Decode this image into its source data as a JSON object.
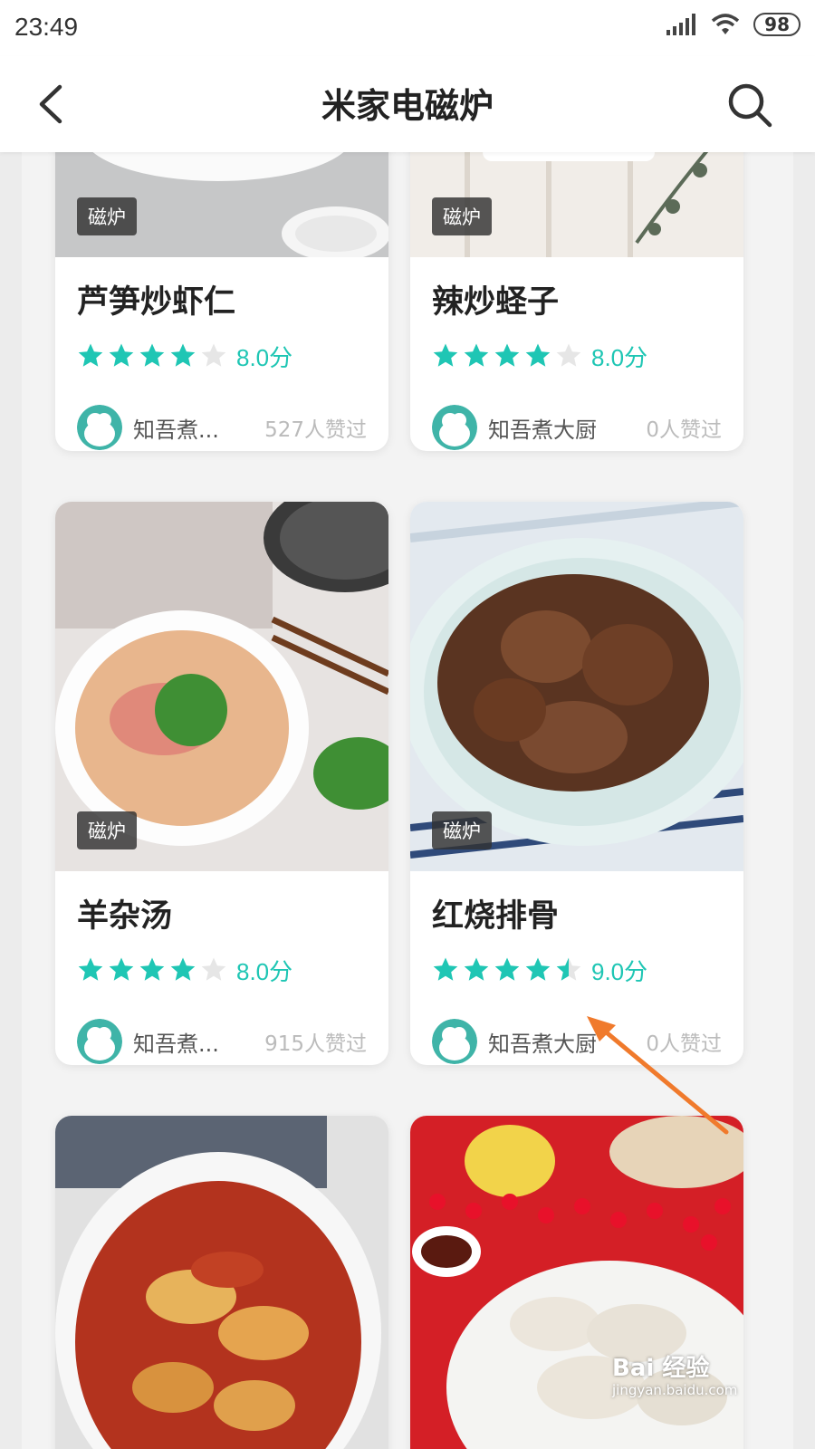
{
  "status": {
    "time": "23:49",
    "battery": "98"
  },
  "header": {
    "title": "米家电磁炉"
  },
  "accent_color": "#1fc6b4",
  "cards": [
    {
      "name": "芦笋炒虾仁",
      "tag": "磁炉",
      "rating_value": 4,
      "score": "8.0分",
      "author": "知吾煮...",
      "likes": "527人赞过"
    },
    {
      "name": "辣炒蛏子",
      "tag": "磁炉",
      "rating_value": 4,
      "score": "8.0分",
      "author": "知吾煮大厨",
      "likes": "0人赞过"
    },
    {
      "name": "羊杂汤",
      "tag": "磁炉",
      "rating_value": 4,
      "score": "8.0分",
      "author": "知吾煮...",
      "likes": "915人赞过"
    },
    {
      "name": "红烧排骨",
      "tag": "磁炉",
      "rating_value": 4.5,
      "score": "9.0分",
      "author": "知吾煮大厨",
      "likes": "0人赞过"
    }
  ],
  "watermark": {
    "brand": "Bai 经验",
    "url": "jingyan.baidu.com"
  }
}
